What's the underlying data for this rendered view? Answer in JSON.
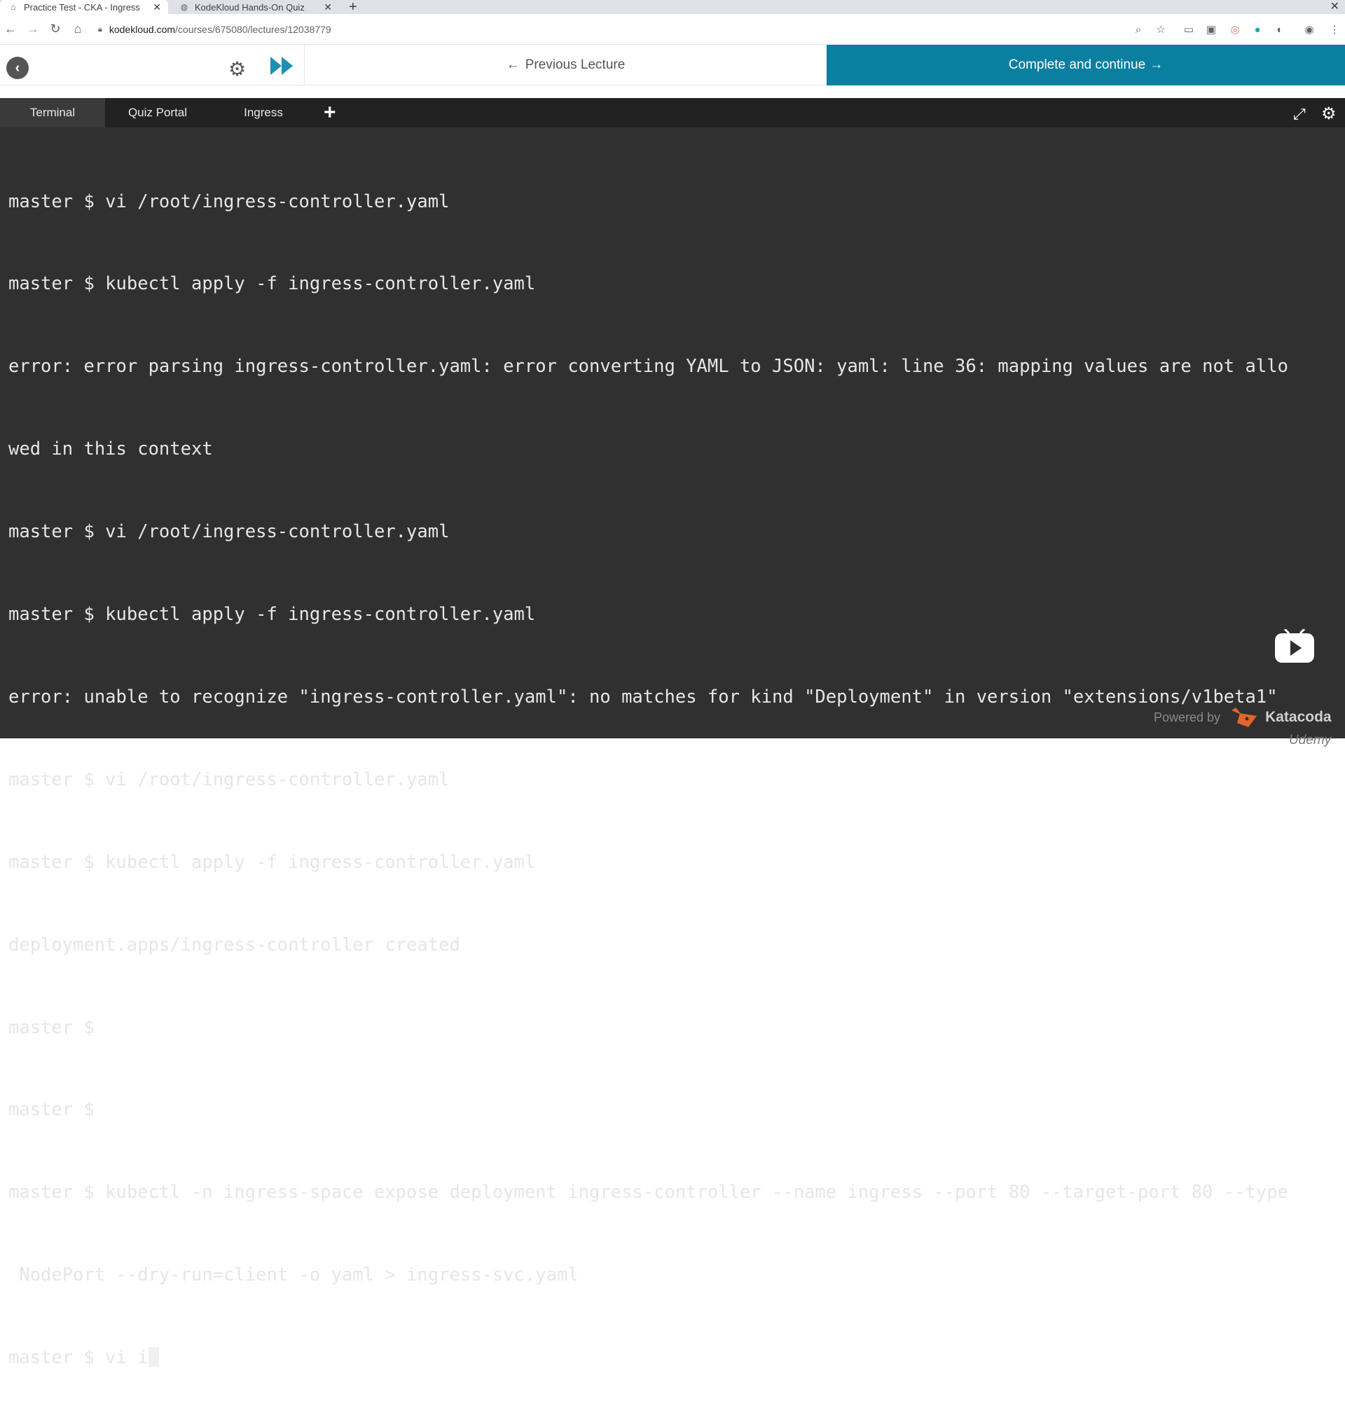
{
  "browser": {
    "tabs": [
      {
        "title": "Practice Test - CKA - Ingress N",
        "active": true
      },
      {
        "title": "KodeKloud Hands-On Quiz",
        "active": false
      }
    ],
    "url_host": "kodekloud.com",
    "url_path": "/courses/675080/lectures/12038779"
  },
  "course_nav": {
    "previous_label": "Previous Lecture",
    "complete_label": "Complete and continue",
    "accent_color": "#0b7fa0"
  },
  "terminal": {
    "tabs": [
      "Terminal",
      "Quiz Portal",
      "Ingress"
    ],
    "active_tab": "Terminal",
    "lines": [
      "master $ vi /root/ingress-controller.yaml",
      "master $ kubectl apply -f ingress-controller.yaml",
      "error: error parsing ingress-controller.yaml: error converting YAML to JSON: yaml: line 36: mapping values are not allo",
      "wed in this context",
      "master $ vi /root/ingress-controller.yaml",
      "master $ kubectl apply -f ingress-controller.yaml",
      "error: unable to recognize \"ingress-controller.yaml\": no matches for kind \"Deployment\" in version \"extensions/v1beta1\"",
      "master $ vi /root/ingress-controller.yaml",
      "master $ kubectl apply -f ingress-controller.yaml",
      "deployment.apps/ingress-controller created",
      "master $",
      "master $",
      "master $ kubectl -n ingress-space expose deployment ingress-controller --name ingress --port 80 --target-port 80 --type",
      " NodePort --dry-run=client -o yaml > ingress-svc.yaml"
    ],
    "current_input": "master $ vi i"
  },
  "footer": {
    "powered_by": "Powered by",
    "brand": "Katacoda",
    "watermark": "Udemy"
  }
}
